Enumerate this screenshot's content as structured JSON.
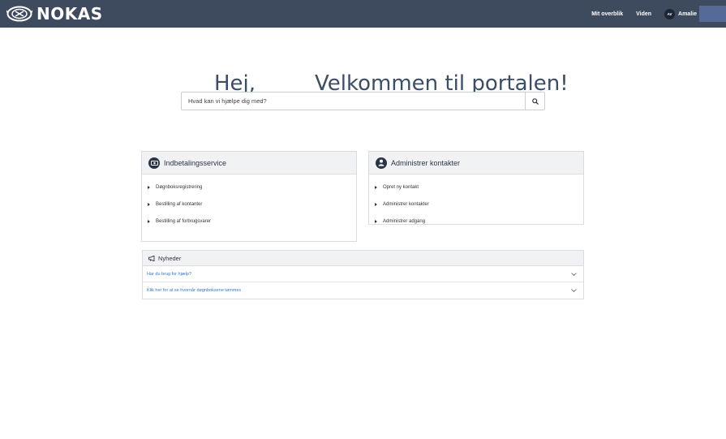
{
  "header": {
    "brand": "NOKAS",
    "nav": [
      "Mit overblik",
      "Viden"
    ],
    "user": {
      "initials": "AV",
      "name": "Amalie"
    },
    "bg_color": "#3e4a5e"
  },
  "hero": {
    "greeting": "Hej,",
    "welcome": "Velkommen til portalen!"
  },
  "search": {
    "placeholder": "Hvad kan vi hjælpe dig med?",
    "icon": "search-icon"
  },
  "cards": [
    {
      "title": "Indbetalingsservice",
      "icon": "money-icon",
      "items": [
        "Døgnboksregistrering",
        "Bestilling af kontanter",
        "Bestilling af forbrugsvarer"
      ]
    },
    {
      "title": "Administrer kontakter",
      "icon": "user-icon",
      "items": [
        "Opret ny kontakt",
        "Administrer kontakter",
        "Administrer adgang"
      ]
    }
  ],
  "news": {
    "title": "Nyheder",
    "icon": "megaphone-icon",
    "items": [
      "Har du brug for hjælp?",
      "Klik her for at se hvornår døgnboksene tømmes"
    ]
  },
  "colors": {
    "link": "#3a78c9",
    "heading": "#3b4d67",
    "panel": "#f1f2f4"
  }
}
